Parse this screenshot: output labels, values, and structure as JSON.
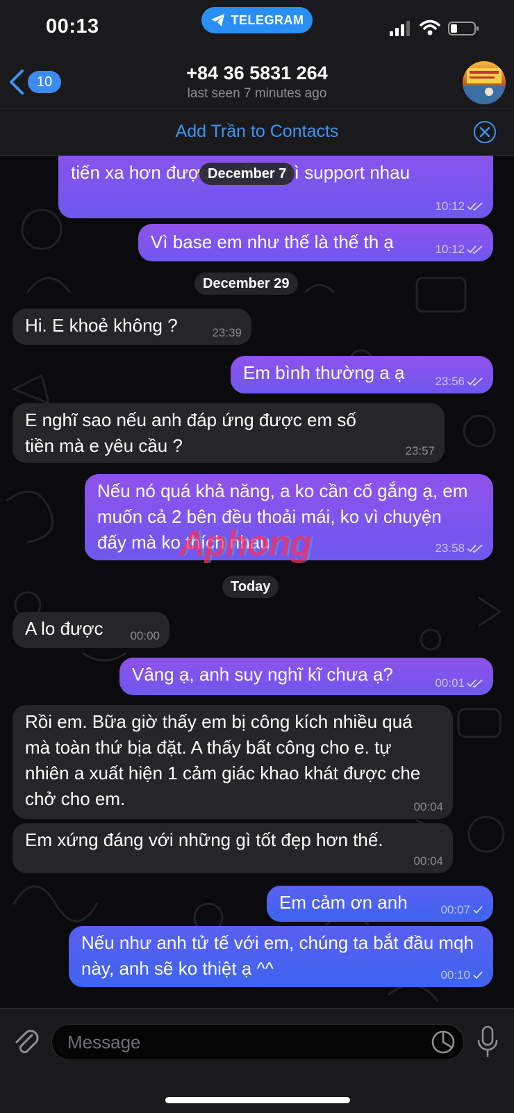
{
  "status_bar": {
    "time": "00:13",
    "app_pill": "TELEGRAM"
  },
  "header": {
    "back_count": "10",
    "title": "+84 36 5831 264",
    "subtitle": "last seen 7 minutes ago"
  },
  "add_contact": {
    "label": "Add Trần to Contacts"
  },
  "dates": [
    "December 7",
    "December 29",
    "Today"
  ],
  "messages": [
    {
      "dir": "out",
      "text": "tiến xa hơn được ... nhau thì support nhau",
      "time": "10:12",
      "ticks": "double"
    },
    {
      "dir": "out",
      "text": "Vì base em như thế là thế th ạ",
      "time": "10:12",
      "ticks": "double"
    },
    {
      "dir": "in",
      "text": "Hi. E khoẻ không ?",
      "time": "23:39"
    },
    {
      "dir": "out",
      "text": "Em bình thường a ạ",
      "time": "23:56",
      "ticks": "double"
    },
    {
      "dir": "in",
      "text": "E nghĩ sao nếu anh đáp ứng được em số tiền mà e yêu cầu ?",
      "time": "23:57"
    },
    {
      "dir": "out",
      "text": "Nếu nó quá khả năng, a ko cần cố gắng ạ, em muốn cả 2 bên đều thoải mái, ko vì chuyện đấy mà ko thích nhau",
      "time": "23:58",
      "ticks": "double"
    },
    {
      "dir": "in",
      "text": "A lo được",
      "time": "00:00"
    },
    {
      "dir": "out",
      "text": "Vâng ạ, anh suy nghĩ kĩ chưa ạ?",
      "time": "00:01",
      "ticks": "double"
    },
    {
      "dir": "in",
      "text": "Rồi em. Bữa giờ thấy em bị công kích nhiều quá mà toàn thứ bịa đặt. A thấy bất công cho e. tự nhiên a xuất hiện 1 cảm giác khao khát được che chở cho em.",
      "time": "00:04"
    },
    {
      "dir": "in",
      "text": "Em xứng đáng với những gì tốt đẹp hơn thế.",
      "time": "00:04"
    },
    {
      "dir": "out",
      "text": "Em cảm ơn anh",
      "time": "00:07",
      "ticks": "single"
    },
    {
      "dir": "out",
      "text": "Nếu như anh tử tế với em, chúng ta bắt đầu mqh này, anh sẽ ko thiệt ạ ^^",
      "time": "00:10",
      "ticks": "single"
    }
  ],
  "watermark": "Aphong",
  "composer": {
    "placeholder": "Message"
  },
  "colors": {
    "accent": "#3e95f2",
    "out_bubble_top": "#8f52ec",
    "out_bubble_blue": "#3d64ef",
    "in_bubble": "#262629"
  },
  "icons": [
    "back-chevron-icon",
    "telegram-plane-icon",
    "signal-icon",
    "wifi-icon",
    "battery-icon",
    "close-circle-icon",
    "paperclip-icon",
    "sticker-icon",
    "microphone-icon"
  ]
}
